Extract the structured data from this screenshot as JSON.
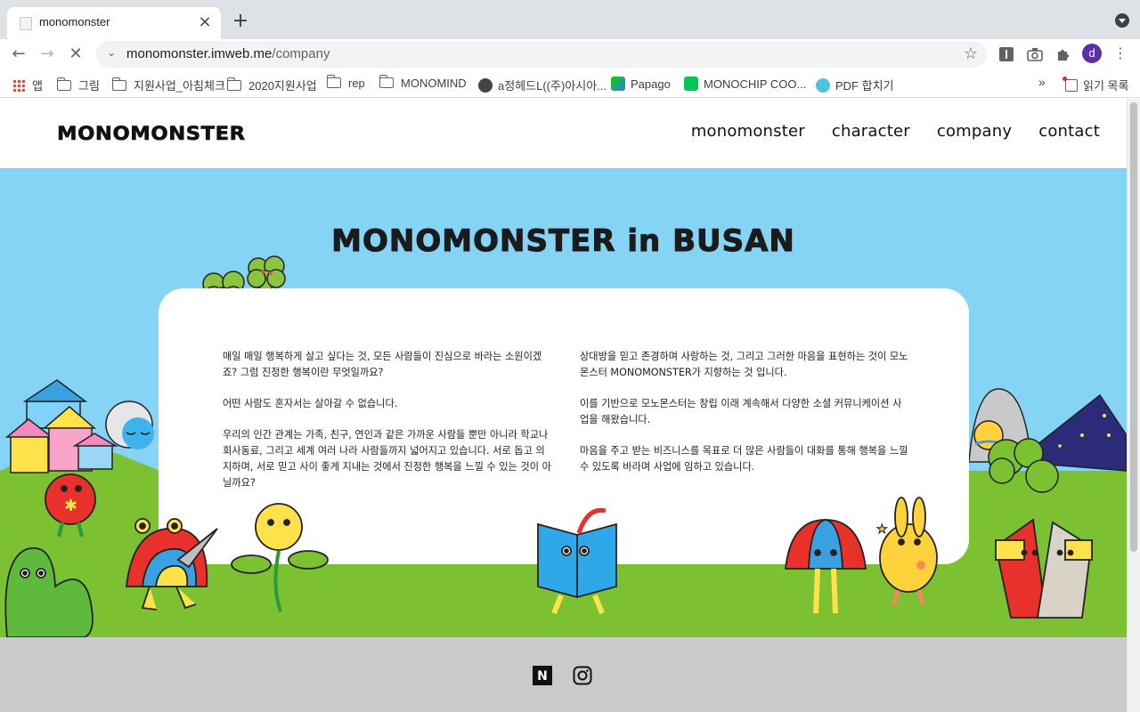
{
  "browser": {
    "tab_title": "monomonster",
    "url_host": "monomonster.imweb.me",
    "url_path": "/company",
    "profile_initial": "d",
    "bookmarks": [
      {
        "label": "앱",
        "icon": "apps-grid-icon"
      },
      {
        "label": "그림",
        "icon": "folder-icon"
      },
      {
        "label": "지원사업_아침체크",
        "icon": "folder-icon"
      },
      {
        "label": "2020지원사업",
        "icon": "folder-icon"
      },
      {
        "label": "rep",
        "icon": "folder-icon"
      },
      {
        "label": "MONOMIND",
        "icon": "folder-icon"
      },
      {
        "label": "a정헤드L((주)아시아...",
        "icon": "globe-icon"
      },
      {
        "label": "Papago",
        "icon": "papago-icon"
      },
      {
        "label": "MONOCHIP COO...",
        "icon": "line-store-icon"
      },
      {
        "label": "PDF 합치기",
        "icon": "pdf-icon"
      }
    ],
    "bookmarks_overflow": "»",
    "reading_list": "읽기 목록"
  },
  "site": {
    "logo": "MONOMONSTER",
    "nav": [
      "monomonster",
      "character",
      "company",
      "contact"
    ],
    "active_nav": "company"
  },
  "hero": {
    "title": "MONOMONSTER in BUSAN",
    "left_paragraphs": [
      "매일 매일 행복하게 살고 싶다는 것, 모든 사람들이 진심으로 바라는 소원이겠죠? 그럼 진정한 행복이란 무엇일까요?",
      "어떤 사람도 혼자서는 살아갈 수 없습니다.",
      "우리의 인간 관계는 가족, 친구, 연인과 같은 가까운 사람들 뿐만 아니라 학교나 회사동료, 그리고 세계 여러 나라 사람들까지 넓어지고 있습니다. 서로 돕고 의지하며, 서로 믿고 사이 좋게 지내는 것에서 진정한 행복을 느낄 수 있는 것이 아닐까요?"
    ],
    "right_paragraphs": [
      "상대방을 믿고 존경하며 사랑하는 것, 그리고 그러한 마음을 표현하는 것이 모노몬스터 MONOMONSTER가 지향하는 것 입니다.",
      "이를 기반으로 모노몬스터는 창립 이래 계속해서 다양한 소셜 커뮤니케이션 사업을 해왔습니다.",
      "마음을 주고 받는 비즈니스를 목표로 더 많은 사람들이 대화를 통해 행복을 느낄 수 있도록 바라며 사업에 임하고 있습니다."
    ]
  },
  "footer": {
    "social": [
      "naver-blog-icon",
      "instagram-icon"
    ],
    "naver_letter": "N"
  },
  "colors": {
    "sky": "#85d4f5",
    "grass": "#7bc132",
    "footer": "#cacaca"
  }
}
